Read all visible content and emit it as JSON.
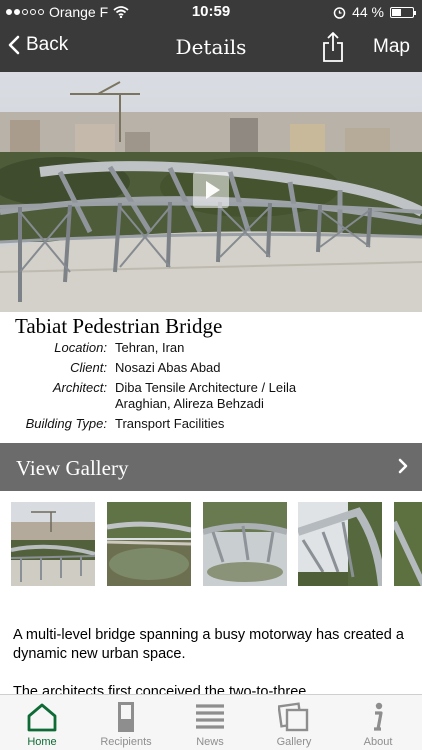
{
  "status_bar": {
    "carrier": "Orange F",
    "time": "10:59",
    "battery_text": "44 %",
    "battery_level": 0.44
  },
  "nav": {
    "back_label": "Back",
    "title": "Details",
    "map_label": "Map"
  },
  "project": {
    "title": "Tabiat Pedestrian Bridge",
    "details": [
      {
        "label": "Location:",
        "value": "Tehran, Iran"
      },
      {
        "label": "Client:",
        "value": "Nosazi Abas Abad"
      },
      {
        "label": "Architect:",
        "value": "Diba Tensile Architecture / Leila Araghian, Alireza Behzadi"
      },
      {
        "label": "Building Type:",
        "value": "Transport Facilities"
      }
    ]
  },
  "gallery": {
    "label": "View Gallery"
  },
  "description": {
    "paragraphs": [
      "A multi-level bridge spanning a busy motorway has created a dynamic new urban space.",
      "The architects first conceived the two-to-three"
    ]
  },
  "tabs": [
    {
      "label": "Home",
      "icon": "home-icon",
      "active": true
    },
    {
      "label": "Recipients",
      "icon": "recipients-icon",
      "active": false
    },
    {
      "label": "News",
      "icon": "news-icon",
      "active": false
    },
    {
      "label": "Gallery",
      "icon": "gallery-icon",
      "active": false
    },
    {
      "label": "About",
      "icon": "about-icon",
      "active": false
    }
  ],
  "colors": {
    "bar_background": "#3a3a3a",
    "gallery_bar": "#6b6b6b",
    "active_tab": "#0e6b35",
    "inactive_tab": "#8e8e8e"
  }
}
